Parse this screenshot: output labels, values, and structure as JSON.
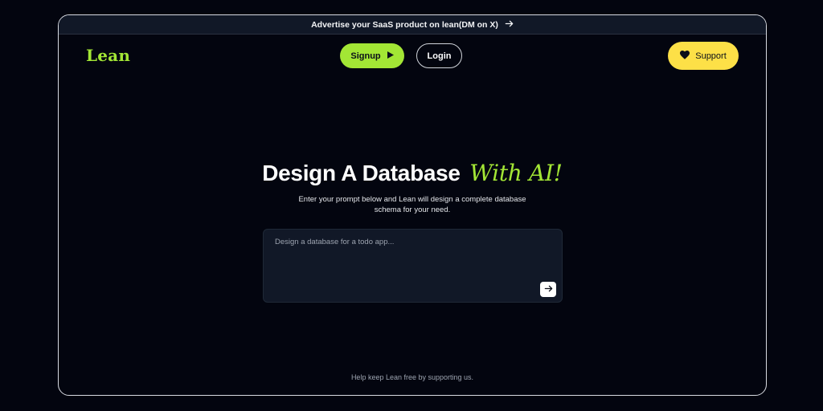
{
  "announcement": {
    "text": "Advertise your SaaS product on lean(DM on X)",
    "icon": "arrow-right-icon"
  },
  "nav": {
    "logo": "Lean",
    "signup_label": "Signup",
    "signup_icon": "play-icon",
    "login_label": "Login",
    "support_label": "Support",
    "support_icon": "heart-icon"
  },
  "hero": {
    "title": "Design A Database",
    "title_accent": "With AI!",
    "subtitle": "Enter your prompt below and Lean will design a complete database schema for your need."
  },
  "prompt": {
    "placeholder": "Design a database for a todo app...",
    "value": "",
    "submit_icon": "arrow-right-icon"
  },
  "footer": {
    "note": "Help keep Lean free by supporting us."
  },
  "colors": {
    "background": "#03050f",
    "accent_green": "#a3e635",
    "accent_yellow": "#fde047",
    "panel": "#111827"
  }
}
